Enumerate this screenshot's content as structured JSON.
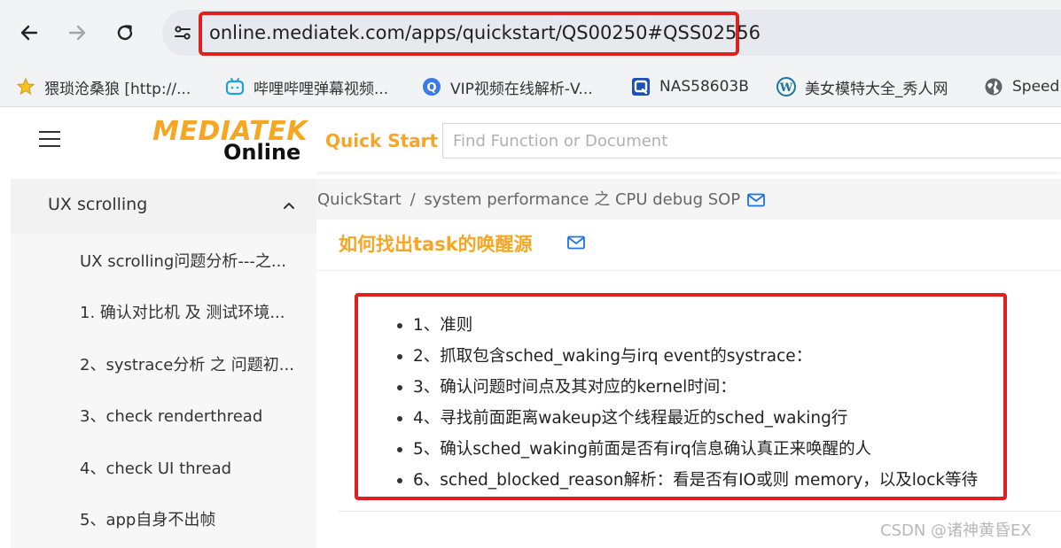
{
  "browser": {
    "url": "online.mediatek.com/apps/quickstart/QS00250#QSS02556",
    "bookmarks": [
      {
        "label": "猥琐沧桑狼 [http://...",
        "icon": "star-icon"
      },
      {
        "label": "哔哩哔哩弹幕视频...",
        "icon": "bilibili-icon"
      },
      {
        "label": "VIP视频在线解析-V...",
        "icon": "q-icon"
      },
      {
        "label": "NAS58603B",
        "icon": "q-square-icon"
      },
      {
        "label": "美女模特大全_秀人网",
        "icon": "wordpress-icon"
      },
      {
        "label": "Speed",
        "icon": "globe-icon"
      }
    ]
  },
  "header": {
    "logo_top": "MEDIATEK",
    "logo_bottom": "Online",
    "quick_start": "Quick Start",
    "search_placeholder": "Find Function or Document"
  },
  "sidebar": {
    "section_title": "UX scrolling",
    "items": [
      "UX scrolling问题分析---之...",
      "1. 确认对比机 及 测试环境...",
      "2、systrace分析 之 问题初...",
      "3、check renderthread",
      "4、check UI thread",
      "5、app自身不出帧"
    ]
  },
  "main": {
    "breadcrumb_root": "QuickStart",
    "breadcrumb_sep": "/",
    "breadcrumb_page": "system performance 之 CPU debug SOP",
    "title": "如何找出task的唤醒源",
    "steps": [
      "1、准则",
      "2、抓取包含sched_waking与irq event的systrace：",
      "3、确认问题时间点及其对应的kernel时间：",
      "4、寻找前面距离wakeup这个线程最近的sched_waking行",
      "5、确认sched_waking前面是否有irq信息确认真正来唤醒的人",
      "6、sched_blocked_reason解析：看是否有IO或则 memory，以及lock等待"
    ]
  },
  "watermark": "CSDN @诸神黄昏EX",
  "colors": {
    "brand_orange": "#f5a623",
    "highlight_red": "#e0201f",
    "link_blue": "#1a73e8"
  }
}
